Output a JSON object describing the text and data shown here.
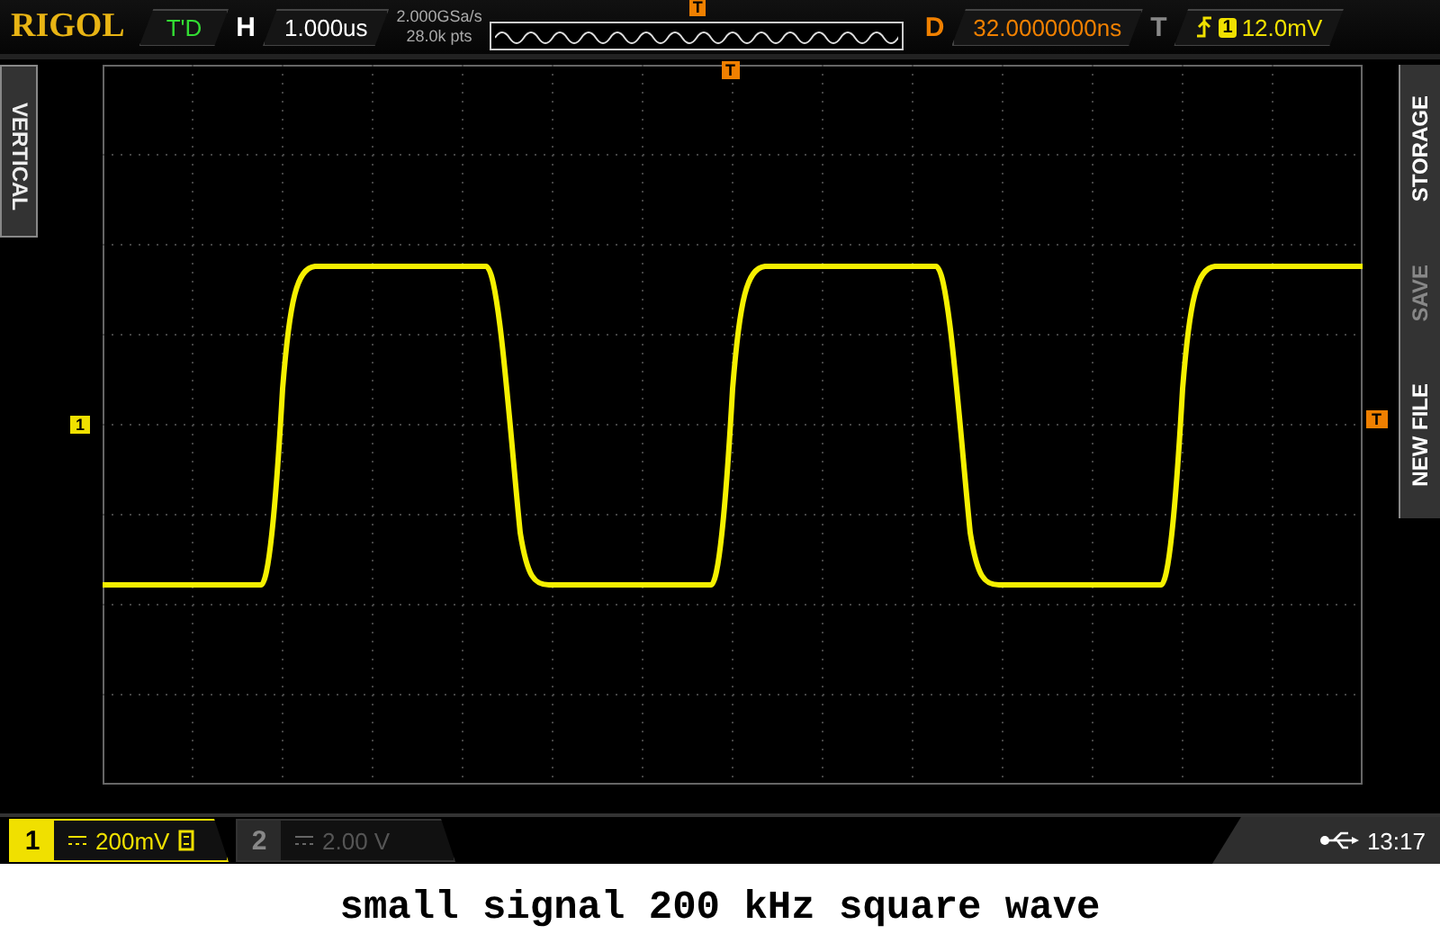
{
  "brand": "RIGOL",
  "run_status": "T'D",
  "horizontal": {
    "label": "H",
    "timebase": "1.000us",
    "sample_rate": "2.000GSa/s",
    "memory_depth": "28.0k pts"
  },
  "delay": {
    "label": "D",
    "value": "32.0000000ns"
  },
  "trigger": {
    "label": "T",
    "source": "1",
    "level": "12.0mV"
  },
  "side_tab": "VERTICAL",
  "menu": [
    {
      "label": "STORAGE",
      "disabled": false
    },
    {
      "label": "SAVE",
      "disabled": true
    },
    {
      "label": "NEW FILE",
      "disabled": false
    }
  ],
  "overview_marker": "T",
  "markers": {
    "trigger_position": "T",
    "channel": "1",
    "trigger_level": "T"
  },
  "channels": [
    {
      "number": "1",
      "scale": "200mV",
      "on": true
    },
    {
      "number": "2",
      "scale": "2.00 V",
      "on": false
    }
  ],
  "status": {
    "time": "13:17"
  },
  "caption": "small signal 200 kHz square wave"
}
